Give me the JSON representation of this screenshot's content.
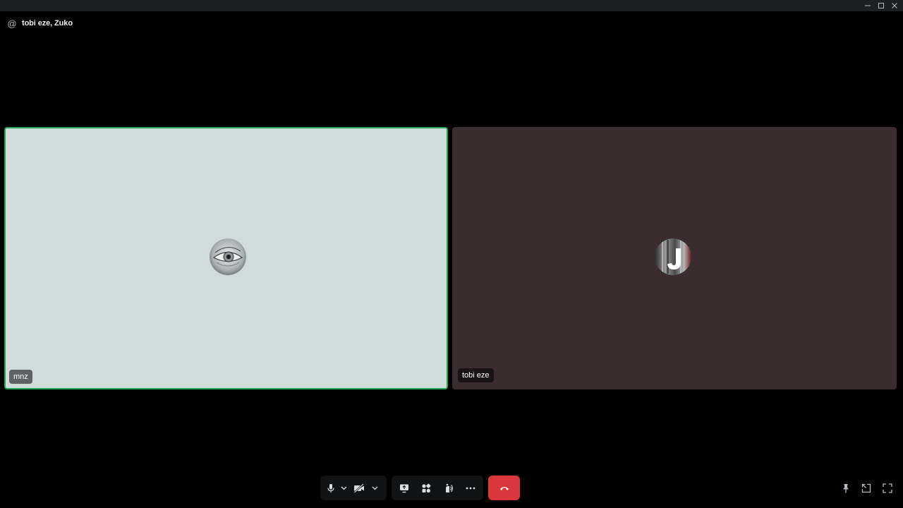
{
  "window": {
    "controls": [
      "minimize-icon",
      "maximize-icon",
      "close-icon"
    ]
  },
  "header": {
    "icon": "at-icon",
    "icon_glyph": "@",
    "title": "tobi eze, Zuko"
  },
  "participants": [
    {
      "name": "mnz",
      "speaking": true,
      "background": "#cfdcdb",
      "avatar": "eye-avatar"
    },
    {
      "name": "tobi eze",
      "speaking": false,
      "background": "#3a2c2f",
      "avatar": "letter-j-avatar"
    }
  ],
  "toolbar": {
    "groups": [
      [
        "microphone-icon",
        "chevron-down-icon",
        "camera-off-icon",
        "chevron-down-icon"
      ],
      [
        "screen-share-icon",
        "activities-icon",
        "soundboard-icon",
        "more-icon"
      ]
    ],
    "hangup": "hangup-icon",
    "right": [
      "pin-icon",
      "popout-icon",
      "fullscreen-icon"
    ]
  },
  "colors": {
    "speaking_border": "#23a55a",
    "hangup": "#da373c",
    "titlebar": "#1e1f22"
  }
}
